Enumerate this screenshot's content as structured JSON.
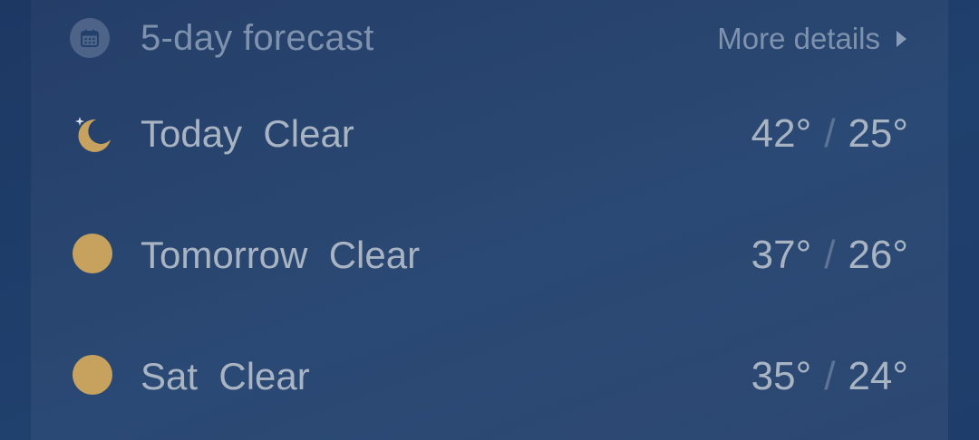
{
  "header": {
    "title": "5-day forecast",
    "more_details": "More details",
    "icon": "calendar-icon"
  },
  "forecast": [
    {
      "day": "Today",
      "condition": "Clear",
      "high": "42°",
      "low": "25°",
      "icon": "moon-icon"
    },
    {
      "day": "Tomorrow",
      "condition": "Clear",
      "high": "37°",
      "low": "26°",
      "icon": "sun-icon"
    },
    {
      "day": "Sat",
      "condition": "Clear",
      "high": "35°",
      "low": "24°",
      "icon": "sun-icon"
    }
  ],
  "separator": "/",
  "colors": {
    "background": "#1e3a66",
    "icon_gold": "#c7a15e",
    "text_primary": "#a9b4c3",
    "text_secondary": "#7f92ad"
  }
}
